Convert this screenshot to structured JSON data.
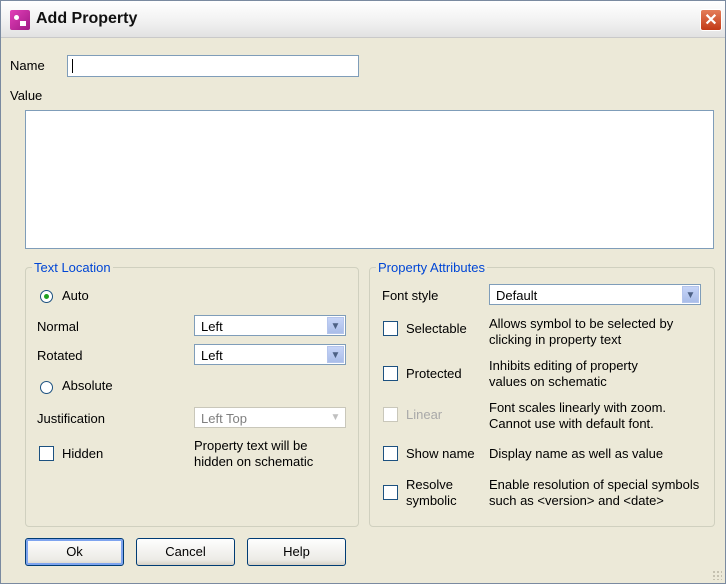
{
  "window": {
    "title": "Add Property",
    "close_glyph": "✕"
  },
  "name_field": {
    "label": "Name",
    "value": ""
  },
  "value_field": {
    "label": "Value",
    "value": ""
  },
  "text_location": {
    "legend": "Text Location",
    "auto_label": "Auto",
    "normal_label": "Normal",
    "normal_value": "Left",
    "rotated_label": "Rotated",
    "rotated_value": "Left",
    "absolute_label": "Absolute",
    "justification_label": "Justification",
    "justification_value": "Left Top",
    "hidden_label": "Hidden",
    "hidden_desc_1": "Property text will be",
    "hidden_desc_2": "hidden on schematic",
    "selected": "Auto"
  },
  "property_attributes": {
    "legend": "Property Attributes",
    "font_style_label": "Font style",
    "font_style_value": "Default",
    "selectable_label": "Selectable",
    "selectable_desc_1": "Allows symbol to be selected by",
    "selectable_desc_2": "clicking in property text",
    "protected_label": "Protected",
    "protected_desc_1": "Inhibits editing of property",
    "protected_desc_2": "values on schematic",
    "linear_label": "Linear",
    "linear_desc_1": "Font scales linearly with zoom.",
    "linear_desc_2": "Cannot use with default font.",
    "show_name_label": "Show name",
    "show_name_desc": "Display name as well as value",
    "resolve_label_1": "Resolve",
    "resolve_label_2": "symbolic",
    "resolve_desc_1": "Enable resolution of special symbols",
    "resolve_desc_2": "such as <version> and <date>"
  },
  "buttons": {
    "ok": "Ok",
    "cancel": "Cancel",
    "help": "Help"
  },
  "icons": {
    "dropdown": "▼"
  }
}
